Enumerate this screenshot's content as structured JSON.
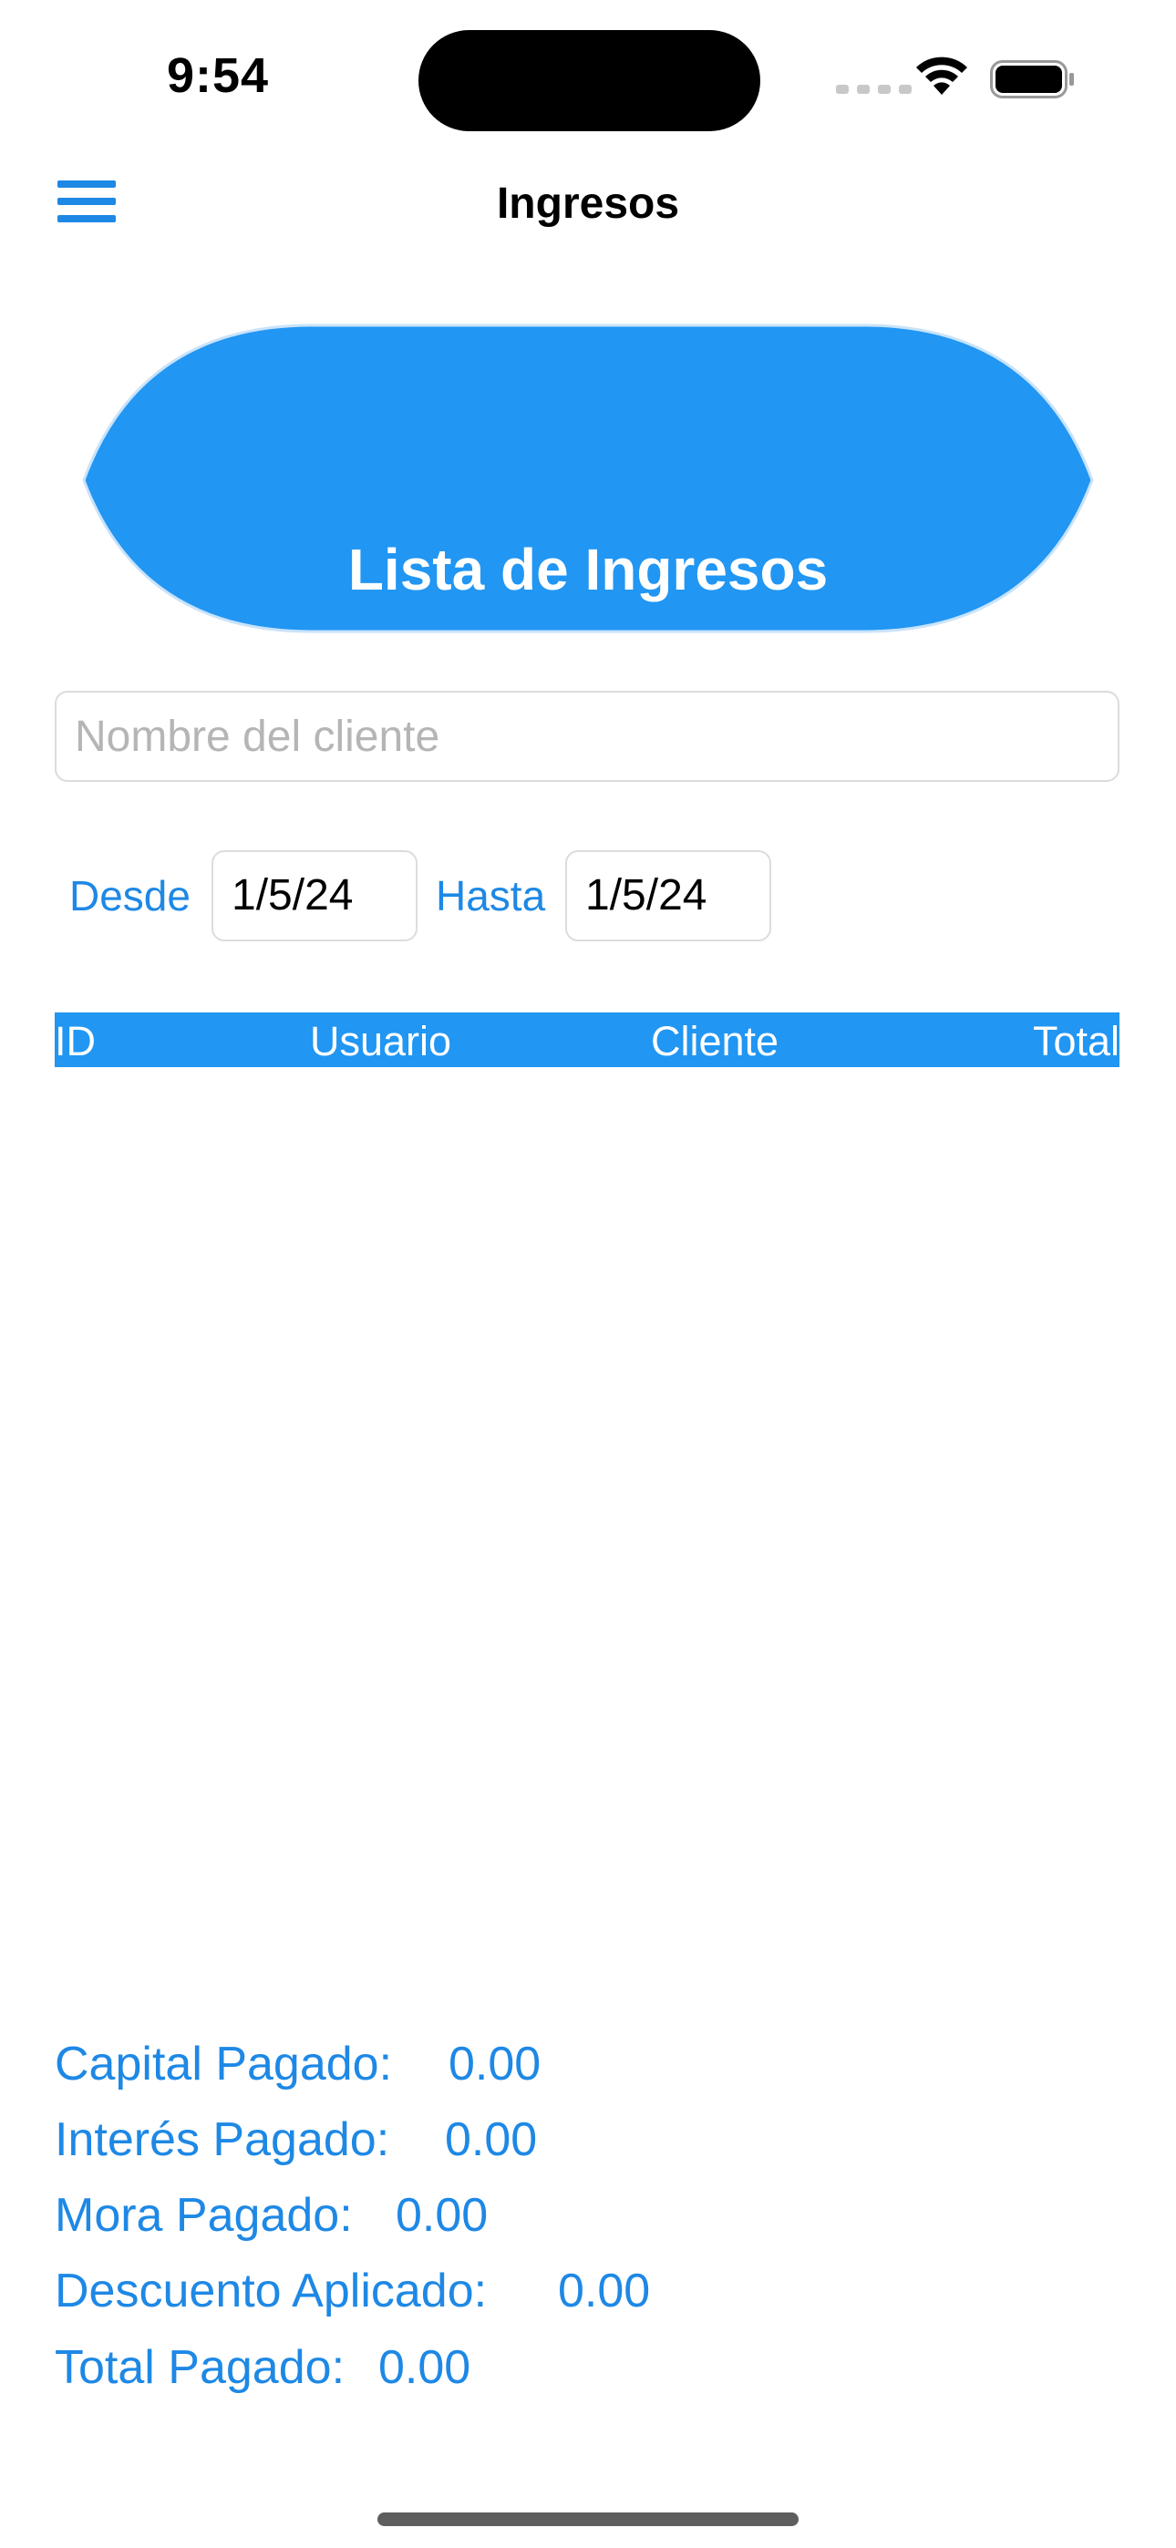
{
  "status_bar": {
    "time": "9:54"
  },
  "nav": {
    "title": "Ingresos",
    "menu_icon": "hamburger-menu-icon"
  },
  "header": {
    "title": "Lista de Ingresos",
    "color": "#2196f3"
  },
  "search": {
    "placeholder": "Nombre del cliente",
    "value": ""
  },
  "filters": {
    "from_label": "Desde",
    "from_value": "1/5/24",
    "to_label": "Hasta",
    "to_value": "1/5/24"
  },
  "table": {
    "columns": [
      "ID",
      "Usuario",
      "Cliente",
      "Total"
    ],
    "rows": []
  },
  "totals": {
    "capital_label": "Capital Pagado:",
    "capital_value": "0.00",
    "interest_label": "Interés Pagado:",
    "interest_value": "0.00",
    "late_label": "Mora Pagado:",
    "late_value": "0.00",
    "discount_label": "Descuento Aplicado:",
    "discount_value": "0.00",
    "total_label": "Total Pagado:",
    "total_value": "0.00"
  },
  "colors": {
    "accent": "#1e88e5",
    "header_blue": "#2196f3"
  }
}
